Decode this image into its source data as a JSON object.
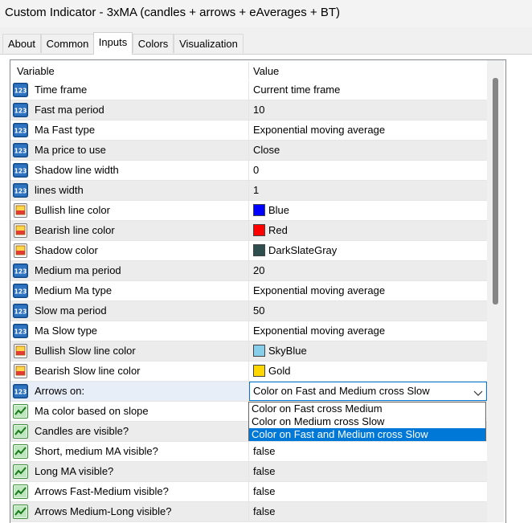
{
  "window": {
    "title": "Custom Indicator - 3xMA (candles + arrows + eAverages + BT)"
  },
  "tabs": [
    {
      "label": "About"
    },
    {
      "label": "Common"
    },
    {
      "label": "Inputs"
    },
    {
      "label": "Colors"
    },
    {
      "label": "Visualization"
    }
  ],
  "active_tab": "Inputs",
  "grid": {
    "columns": {
      "variable": "Variable",
      "value": "Value"
    },
    "rows": [
      {
        "icon": "numeric-123-icon",
        "name": "Time frame",
        "value": "Current time frame"
      },
      {
        "icon": "numeric-123-icon",
        "name": "Fast ma period",
        "value": "10"
      },
      {
        "icon": "numeric-123-icon",
        "name": "Ma Fast type",
        "value": "Exponential moving average"
      },
      {
        "icon": "numeric-123-icon",
        "name": "Ma  price to use",
        "value": "Close"
      },
      {
        "icon": "numeric-123-icon",
        "name": "Shadow  line width",
        "value": "0"
      },
      {
        "icon": "numeric-123-icon",
        "name": "lines   width",
        "value": "1"
      },
      {
        "icon": "color-palette-icon",
        "name": "Bullish  line  color",
        "value": "Blue",
        "swatch": "#0000ff"
      },
      {
        "icon": "color-palette-icon",
        "name": "Bearish  line  color",
        "value": "Red",
        "swatch": "#ff0000"
      },
      {
        "icon": "color-palette-icon",
        "name": "Shadow  color",
        "value": "DarkSlateGray",
        "swatch": "#2f4f4f"
      },
      {
        "icon": "numeric-123-icon",
        "name": "Medium ma period",
        "value": "20"
      },
      {
        "icon": "numeric-123-icon",
        "name": "Medium Ma type",
        "value": "Exponential moving average"
      },
      {
        "icon": "numeric-123-icon",
        "name": "Slow ma period",
        "value": "50"
      },
      {
        "icon": "numeric-123-icon",
        "name": "Ma Slow type",
        "value": "Exponential moving average"
      },
      {
        "icon": "color-palette-icon",
        "name": "Bullish Slow line  color",
        "value": "SkyBlue",
        "swatch": "#87ceeb"
      },
      {
        "icon": "color-palette-icon",
        "name": "Bearish Slow line  color",
        "value": "Gold",
        "swatch": "#ffd700"
      },
      {
        "icon": "numeric-123-icon",
        "name": "Arrows on:",
        "value": "Color on Fast and Medium cross Slow",
        "combo": true,
        "selected": true
      },
      {
        "icon": "boolean-chart-icon",
        "name": "Ma color based on slope",
        "value": ""
      },
      {
        "icon": "boolean-chart-icon",
        "name": "Candles are visible?",
        "value": ""
      },
      {
        "icon": "boolean-chart-icon",
        "name": "Short, medium MA visible?",
        "value": "false"
      },
      {
        "icon": "boolean-chart-icon",
        "name": "Long MA visible?",
        "value": "false"
      },
      {
        "icon": "boolean-chart-icon",
        "name": "Arrows Fast-Medium visible?",
        "value": "false"
      },
      {
        "icon": "boolean-chart-icon",
        "name": "Arrows Medium-Long visible?",
        "value": "false"
      }
    ]
  },
  "dropdown": {
    "options": [
      "Color on Fast cross Medium",
      "Color on Medium cross Slow",
      "Color on Fast and Medium cross Slow"
    ],
    "highlighted": "Color on Fast and Medium cross Slow"
  },
  "colors": {
    "accent": "#0078d7",
    "row_alt": "#ececec",
    "selection": "#e8eef8"
  }
}
